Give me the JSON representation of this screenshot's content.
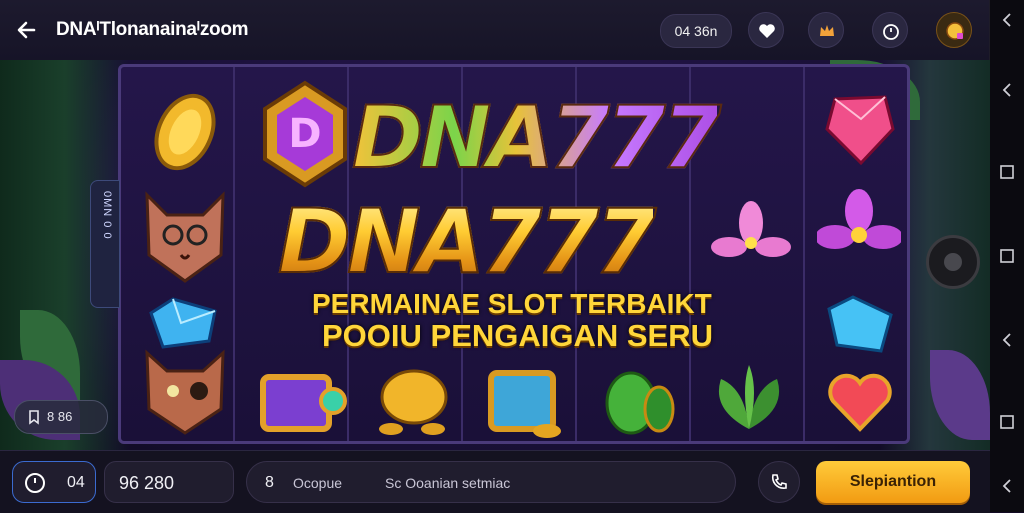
{
  "header": {
    "title": "DNAᴵTlonanainaᴵzoom",
    "balance": "04 36n",
    "icons": [
      "back-arrow-icon",
      "heart-icon",
      "crown-icon",
      "timer-icon",
      "rank-badge-icon"
    ]
  },
  "game": {
    "logo_line1": "DNA777",
    "logo_line2": "DNA777",
    "tagline_line1": "PERMAINAE SLOT TERBAIKT",
    "tagline_line2": "POOIU PENGAIGAN SERU",
    "side_tab_label": "0MN 0 0",
    "chip_value": "8 86",
    "symbols": [
      "gold-coin",
      "d-gem-badge",
      "wolf-with-glasses",
      "blue-crystal",
      "wolf-eyepatch",
      "gift-box",
      "golden-dumpling",
      "green-melon",
      "green-leaves",
      "red-heart-gem",
      "pink-diamond",
      "pink-flower",
      "blue-crystal-right"
    ]
  },
  "bottom": {
    "left_pill_text": "04",
    "amount": "96 280",
    "input_prefix": "8",
    "input_label_1": "Ocopue",
    "input_label_2": "Sc Ooanian setmiac",
    "cta_label": "Slepiantion"
  },
  "colors": {
    "accent_gold": "#ffcb3a",
    "panel": "#201d2e",
    "stage_purple": "#3b1f6a"
  }
}
